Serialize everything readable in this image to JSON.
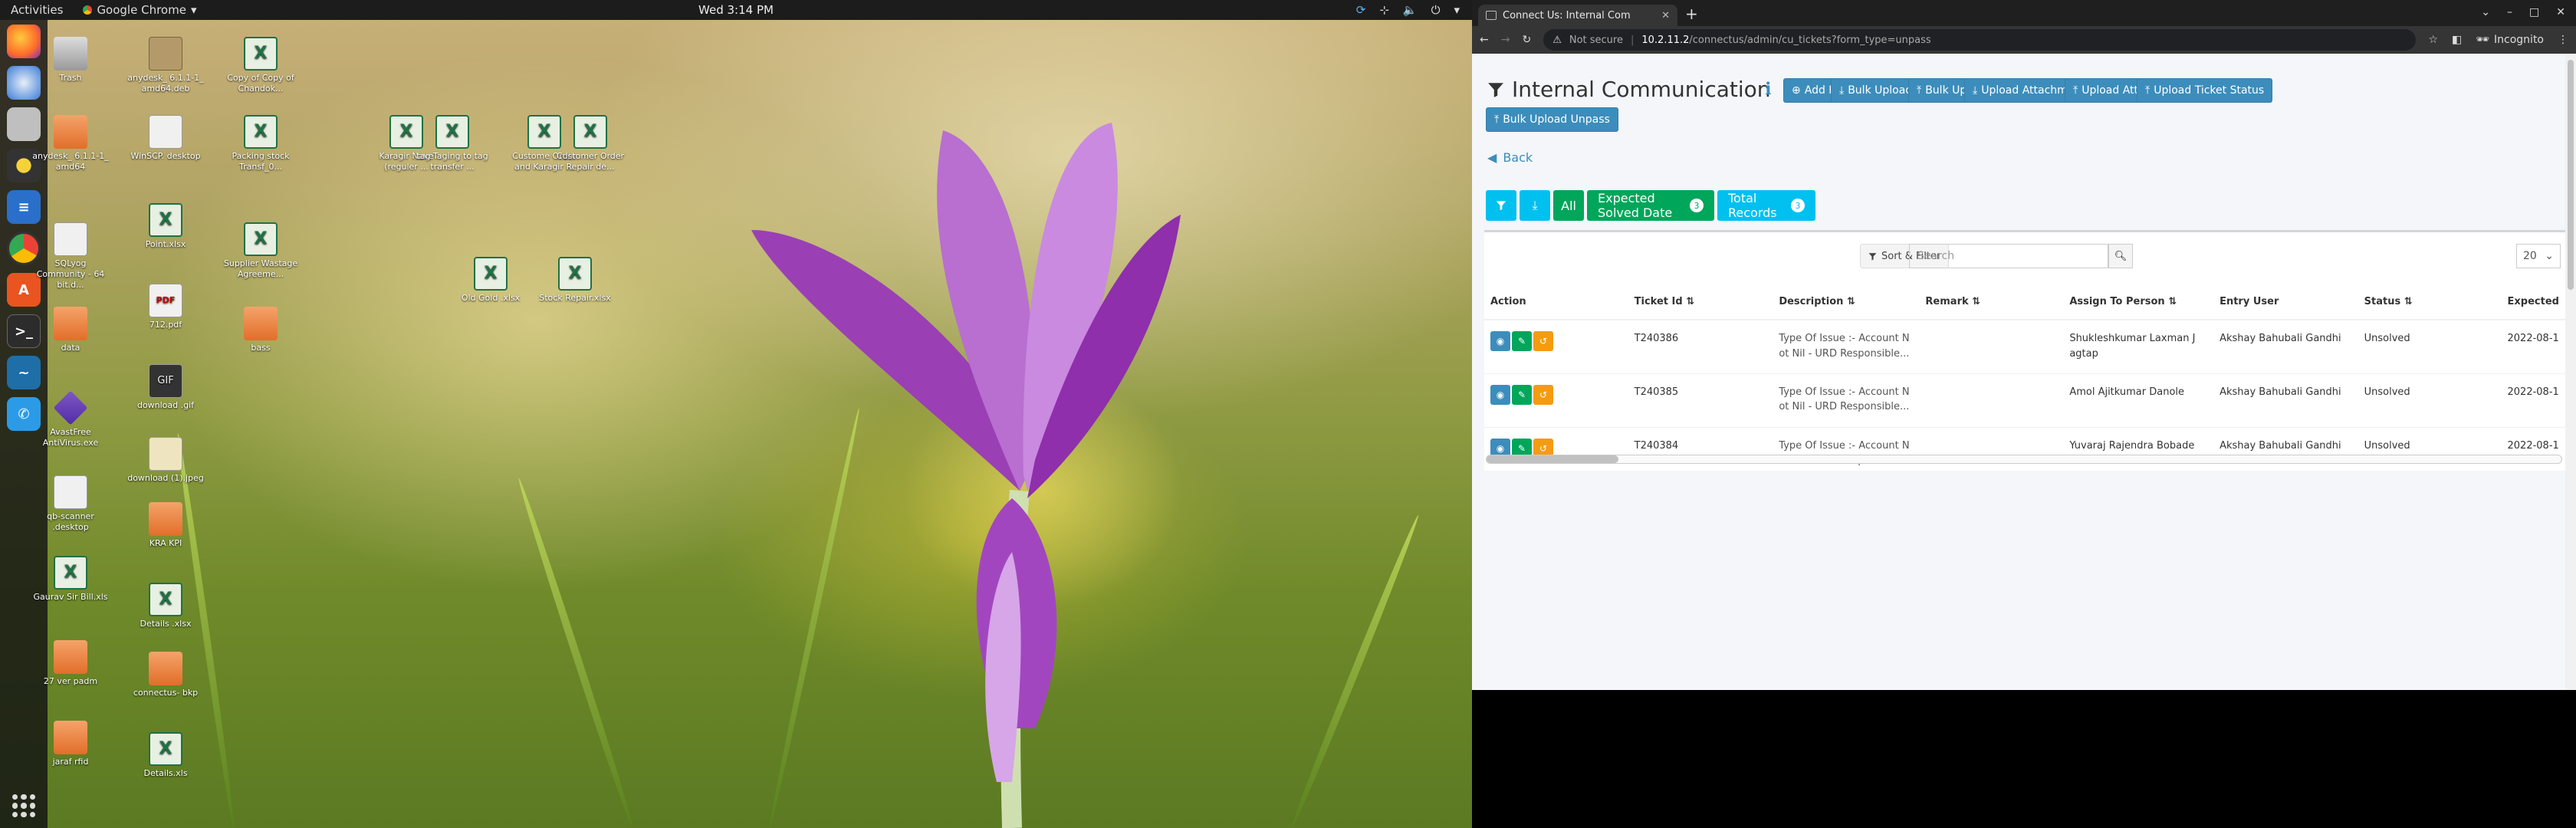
{
  "topbar": {
    "activities": "Activities",
    "app_name": "Google Chrome",
    "clock": "Wed  3:14 PM"
  },
  "dock": {
    "apps": [
      "firefox-icon",
      "thunderbird-icon",
      "files-icon",
      "rhythmbox-icon",
      "libreoffice-writer-icon",
      "chrome-icon",
      "software-icon",
      "terminal-icon",
      "mysql-workbench-icon",
      "phone-icon"
    ]
  },
  "desktop": {
    "icons": [
      {
        "name": "trash",
        "label": "Trash",
        "type": "trash"
      },
      {
        "name": "anydesk-deb",
        "label": "anydesk_ 6.1.1-1_ amd64.deb",
        "type": "deb"
      },
      {
        "name": "copy-chandok",
        "label": "Copy of Copy of Chandok...",
        "type": "xls"
      },
      {
        "name": "anydesk-folder",
        "label": "anydesk_ 6.1.1-1_ amd64",
        "type": "folder"
      },
      {
        "name": "winscp",
        "label": "WinSCP. desktop",
        "type": "doc"
      },
      {
        "name": "packing-stock",
        "label": "Packing stock Transf_0...",
        "type": "xls"
      },
      {
        "name": "karagir-nave",
        "label": "Karagir Nave (reguler ...",
        "type": "xls"
      },
      {
        "name": "tag-transfer",
        "label": "tag Taging to tag transfer ...",
        "type": "xls"
      },
      {
        "name": "customer-order",
        "label": "Custome Order and Karagir ...",
        "type": "xls"
      },
      {
        "name": "customer-repair",
        "label": "Customer Order Repair de...",
        "type": "xls"
      },
      {
        "name": "sqlyog",
        "label": "SQLyog Community - 64 bit.d...",
        "type": "doc"
      },
      {
        "name": "point-xlsx",
        "label": "Point.xlsx",
        "type": "xls"
      },
      {
        "name": "supplier-wastage",
        "label": "Supplier Wastage Agreeme...",
        "type": "xls"
      },
      {
        "name": "old-gold",
        "label": "Old Gold .xlsx",
        "type": "xls"
      },
      {
        "name": "stock-repair",
        "label": "Stock Repair.xlsx",
        "type": "xls"
      },
      {
        "name": "data-folder",
        "label": "data",
        "type": "folder"
      },
      {
        "name": "712-pdf",
        "label": "712.pdf",
        "type": "pdf"
      },
      {
        "name": "bass-folder",
        "label": "bass",
        "type": "folder"
      },
      {
        "name": "avast",
        "label": "AvastFree AntiVirus.exe",
        "type": "exe"
      },
      {
        "name": "download-gif",
        "label": "download .gif",
        "type": "gif"
      },
      {
        "name": "download-jpeg",
        "label": "download (1).jpeg",
        "type": "jpg"
      },
      {
        "name": "qb-scanner",
        "label": "qb-scanner .desktop",
        "type": "doc"
      },
      {
        "name": "kra-kpi",
        "label": "KRA KPI",
        "type": "folder"
      },
      {
        "name": "gaurav-sir",
        "label": "Gaurav Sir Bill.xls",
        "type": "xls"
      },
      {
        "name": "details-xlsx",
        "label": "Details .xlsx",
        "type": "xls"
      },
      {
        "name": "27-ver",
        "label": "27 ver padm",
        "type": "folder"
      },
      {
        "name": "connectus-bkp",
        "label": "connectus- bkp",
        "type": "folder"
      },
      {
        "name": "jaraf-rfid",
        "label": "jaraf rfid",
        "type": "folder"
      },
      {
        "name": "details-xls",
        "label": "Details.xls",
        "type": "xls"
      }
    ]
  },
  "browser": {
    "tab_title": "Connect Us: Internal Com",
    "url_not_secure": "Not secure",
    "url_host": "10.2.11.2",
    "url_path": "/connectus/admin/cu_tickets?form_type=unpass",
    "profile": "Incognito"
  },
  "page": {
    "title": "Internal Communication",
    "buttons": {
      "add_data": "Add Data",
      "bulk_upload_format": "Bulk Upload Format",
      "bulk_upload": "Bulk Upload",
      "upload_attachment_format": "Upload Attachment Format",
      "upload_attachment": "Upload Attachment",
      "upload_ticket_status": "Upload Ticket Status",
      "bulk_upload_unpass": "Bulk Upload Unpass"
    },
    "back": "Back",
    "filters": {
      "all": "All",
      "expected_solved_date": "Expected Solved Date",
      "expected_solved_count": "3",
      "total_records": "Total Records",
      "total_count": "3"
    },
    "toolbar": {
      "sort_filter": "Sort & Filter",
      "search_placeholder": "Search",
      "page_size": "20"
    },
    "table": {
      "columns": [
        "Action",
        "Ticket Id",
        "Description",
        "Remark",
        "Assign To Person",
        "Entry User",
        "Status",
        "Expected"
      ],
      "rows": [
        {
          "ticket": "T240386",
          "desc": "Type Of Issue :- Account N ot Nil - URD Responsible...",
          "remark": "",
          "assign": "Shukleshkumar Laxman J agtap",
          "entry": "Akshay Bahubali Gandhi",
          "status": "Unsolved",
          "expected": "2022-08-1"
        },
        {
          "ticket": "T240385",
          "desc": "Type Of Issue :- Account N ot Nil - URD Responsible...",
          "remark": "",
          "assign": "Amol Ajitkumar Danole",
          "entry": "Akshay Bahubali Gandhi",
          "status": "Unsolved",
          "expected": "2022-08-1"
        },
        {
          "ticket": "T240384",
          "desc": "Type Of Issue :- Account N ot Nil - URD Responsible...",
          "remark": "",
          "assign": "Yuvaraj Rajendra Bobade",
          "entry": "Akshay Bahubali Gandhi",
          "status": "Unsolved",
          "expected": "2022-08-1"
        }
      ]
    }
  }
}
